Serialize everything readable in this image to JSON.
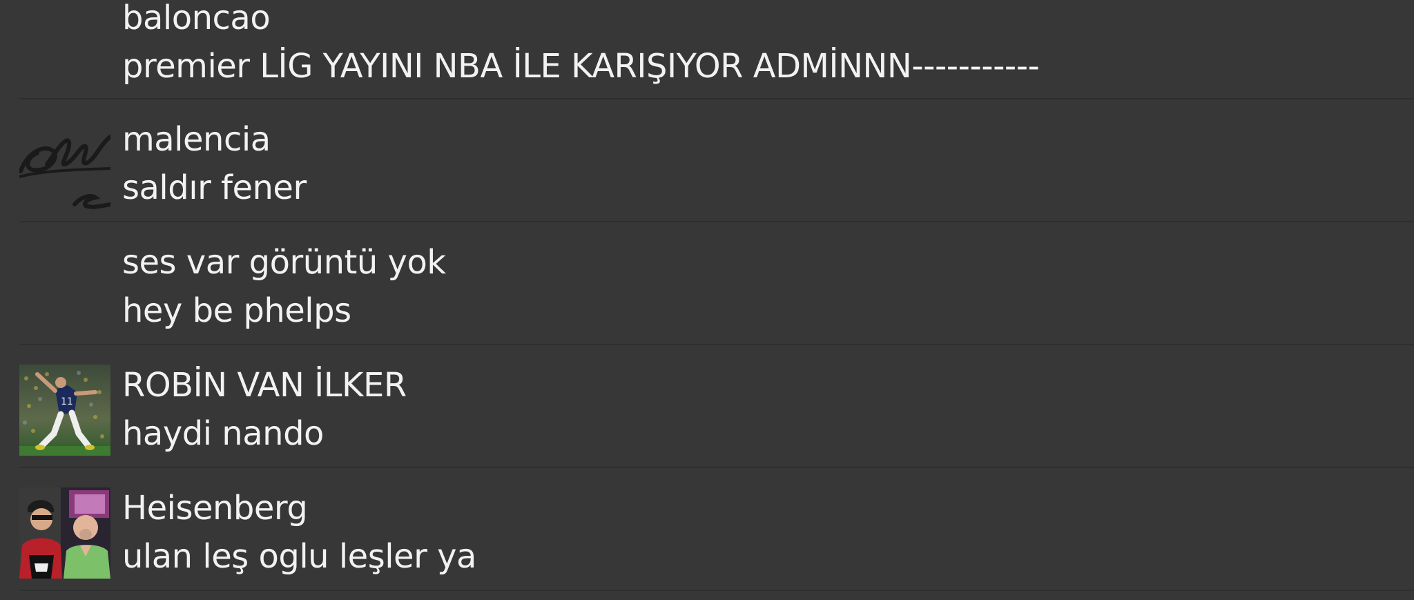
{
  "messages": [
    {
      "username": "baloncao",
      "text": "premier LİG YAYINI NBA İLE KARIŞIYOR ADMİNNN-----------",
      "avatar": "none"
    },
    {
      "username": "malencia",
      "text": "saldır fener",
      "avatar": "signature-avatar"
    },
    {
      "username": "ses var görüntü yok",
      "text": "hey be phelps",
      "avatar": "none"
    },
    {
      "username": "ROBİN VAN İLKER",
      "text": "haydi nando",
      "avatar": "football-player-avatar"
    },
    {
      "username": "Heisenberg",
      "text": "ulan leş oglu leşler ya",
      "avatar": "two-men-photo-avatar"
    }
  ],
  "colors": {
    "background": "#373737",
    "divider": "#2e2e2e",
    "text": "#f2f2f2"
  }
}
